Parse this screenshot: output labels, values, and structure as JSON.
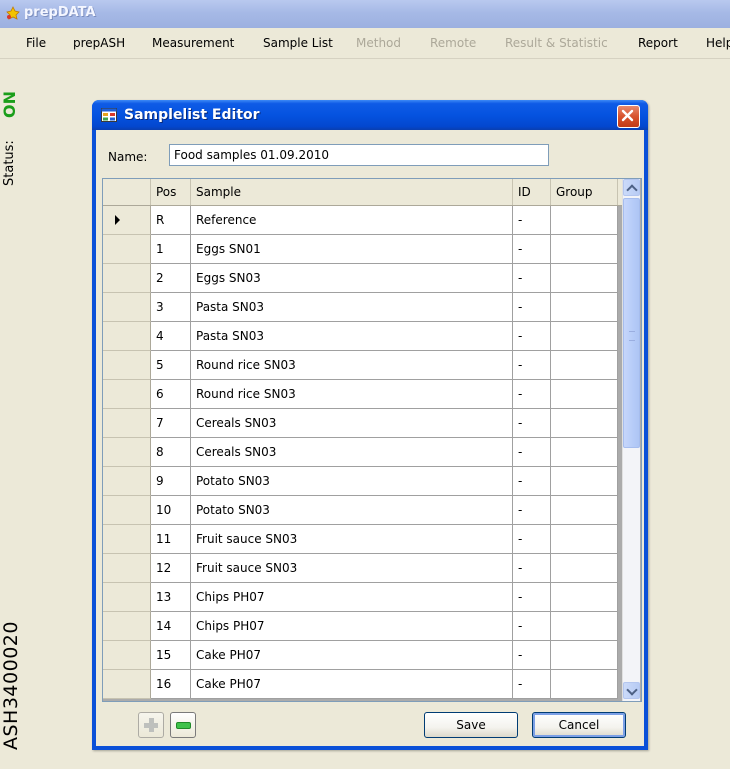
{
  "app": {
    "title": "prepDATA"
  },
  "menu": [
    {
      "label": "File",
      "enabled": true
    },
    {
      "label": "prepASH",
      "enabled": true
    },
    {
      "label": "Measurement",
      "enabled": true
    },
    {
      "label": "Sample List",
      "enabled": true
    },
    {
      "label": "Method",
      "enabled": false
    },
    {
      "label": "Remote",
      "enabled": false
    },
    {
      "label": "Result & Statistic",
      "enabled": false
    },
    {
      "label": "Report",
      "enabled": true
    },
    {
      "label": "Help",
      "enabled": true
    }
  ],
  "status": {
    "label": "Status:",
    "value": "ON",
    "value_color": "#1a9e1a",
    "device_id": "ASH3400020"
  },
  "dialog": {
    "title": "Samplelist Editor",
    "name_label": "Name:",
    "name_value": "Food samples 01.09.2010",
    "columns": {
      "pos": "Pos",
      "sample": "Sample",
      "id": "ID",
      "group": "Group"
    },
    "rows": [
      {
        "pos": "R",
        "sample": "Reference",
        "id": "-",
        "group": "",
        "current": true
      },
      {
        "pos": "1",
        "sample": "Eggs SN01",
        "id": "-",
        "group": ""
      },
      {
        "pos": "2",
        "sample": "Eggs SN03",
        "id": "-",
        "group": ""
      },
      {
        "pos": "3",
        "sample": "Pasta SN03",
        "id": "-",
        "group": ""
      },
      {
        "pos": "4",
        "sample": "Pasta SN03",
        "id": "-",
        "group": ""
      },
      {
        "pos": "5",
        "sample": "Round rice SN03",
        "id": "-",
        "group": ""
      },
      {
        "pos": "6",
        "sample": "Round rice SN03",
        "id": "-",
        "group": ""
      },
      {
        "pos": "7",
        "sample": "Cereals SN03",
        "id": "-",
        "group": ""
      },
      {
        "pos": "8",
        "sample": "Cereals SN03",
        "id": "-",
        "group": ""
      },
      {
        "pos": "9",
        "sample": " Potato SN03",
        "id": "-",
        "group": ""
      },
      {
        "pos": "10",
        "sample": " Potato SN03",
        "id": "-",
        "group": ""
      },
      {
        "pos": "11",
        "sample": "Fruit sauce SN03",
        "id": "-",
        "group": ""
      },
      {
        "pos": "12",
        "sample": "Fruit sauce SN03",
        "id": "-",
        "group": ""
      },
      {
        "pos": "13",
        "sample": "Chips PH07",
        "id": "-",
        "group": ""
      },
      {
        "pos": "14",
        "sample": "Chips PH07",
        "id": "-",
        "group": ""
      },
      {
        "pos": "15",
        "sample": "Cake PH07",
        "id": "-",
        "group": ""
      },
      {
        "pos": "16",
        "sample": "Cake PH07",
        "id": "-",
        "group": ""
      }
    ],
    "buttons": {
      "add_icon": "plus-icon",
      "remove_icon": "minus-icon",
      "save": "Save",
      "cancel": "Cancel"
    }
  }
}
